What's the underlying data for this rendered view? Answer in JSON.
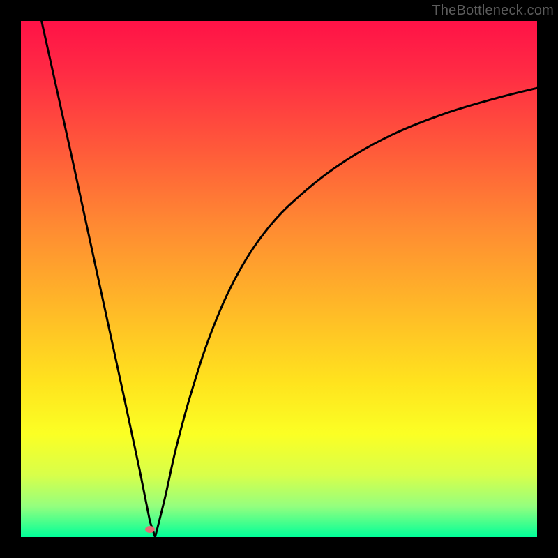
{
  "watermark": "TheBottleneck.com",
  "colors": {
    "frame": "#000000",
    "gradient_stops": [
      {
        "offset": 0.0,
        "color": "#ff1247"
      },
      {
        "offset": 0.1,
        "color": "#ff2b44"
      },
      {
        "offset": 0.25,
        "color": "#ff5a3a"
      },
      {
        "offset": 0.4,
        "color": "#ff8b32"
      },
      {
        "offset": 0.55,
        "color": "#ffb728"
      },
      {
        "offset": 0.7,
        "color": "#ffe31e"
      },
      {
        "offset": 0.8,
        "color": "#fbff24"
      },
      {
        "offset": 0.88,
        "color": "#d8ff4a"
      },
      {
        "offset": 0.94,
        "color": "#95ff7e"
      },
      {
        "offset": 1.0,
        "color": "#00ff99"
      }
    ],
    "curve": "#000000",
    "marker": "#e46c74"
  },
  "chart_data": {
    "type": "line",
    "title": "",
    "xlabel": "",
    "ylabel": "",
    "xlim": [
      0,
      100
    ],
    "ylim": [
      0,
      100
    ],
    "series": [
      {
        "name": "left-branch",
        "x": [
          4,
          10,
          15,
          20,
          23,
          25,
          26
        ],
        "values": [
          100,
          73,
          50,
          27,
          13,
          3,
          0
        ]
      },
      {
        "name": "right-branch",
        "x": [
          26,
          28,
          30,
          33,
          37,
          42,
          48,
          55,
          63,
          72,
          82,
          92,
          100
        ],
        "values": [
          0,
          8,
          17,
          28,
          40,
          51,
          60,
          67,
          73,
          78,
          82,
          85,
          87
        ]
      }
    ],
    "marker": {
      "x": 25,
      "y": 1.5
    },
    "annotations": [],
    "legend": []
  }
}
